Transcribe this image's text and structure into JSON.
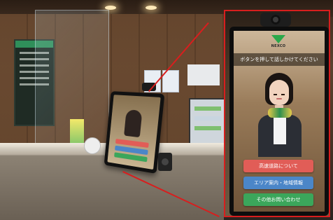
{
  "kiosk": {
    "logo_text": "NEXCO",
    "prompt": "ボタンを押して話しかけてください",
    "buttons": [
      {
        "label": "高速道路について",
        "color": "#e15d57"
      },
      {
        "label": "エリア案内・地域情報",
        "color": "#4b86c8"
      },
      {
        "label": "その他お問い合わせ",
        "color": "#3ba65b"
      }
    ]
  },
  "colors": {
    "zoom_highlight": "#d81e1e"
  }
}
